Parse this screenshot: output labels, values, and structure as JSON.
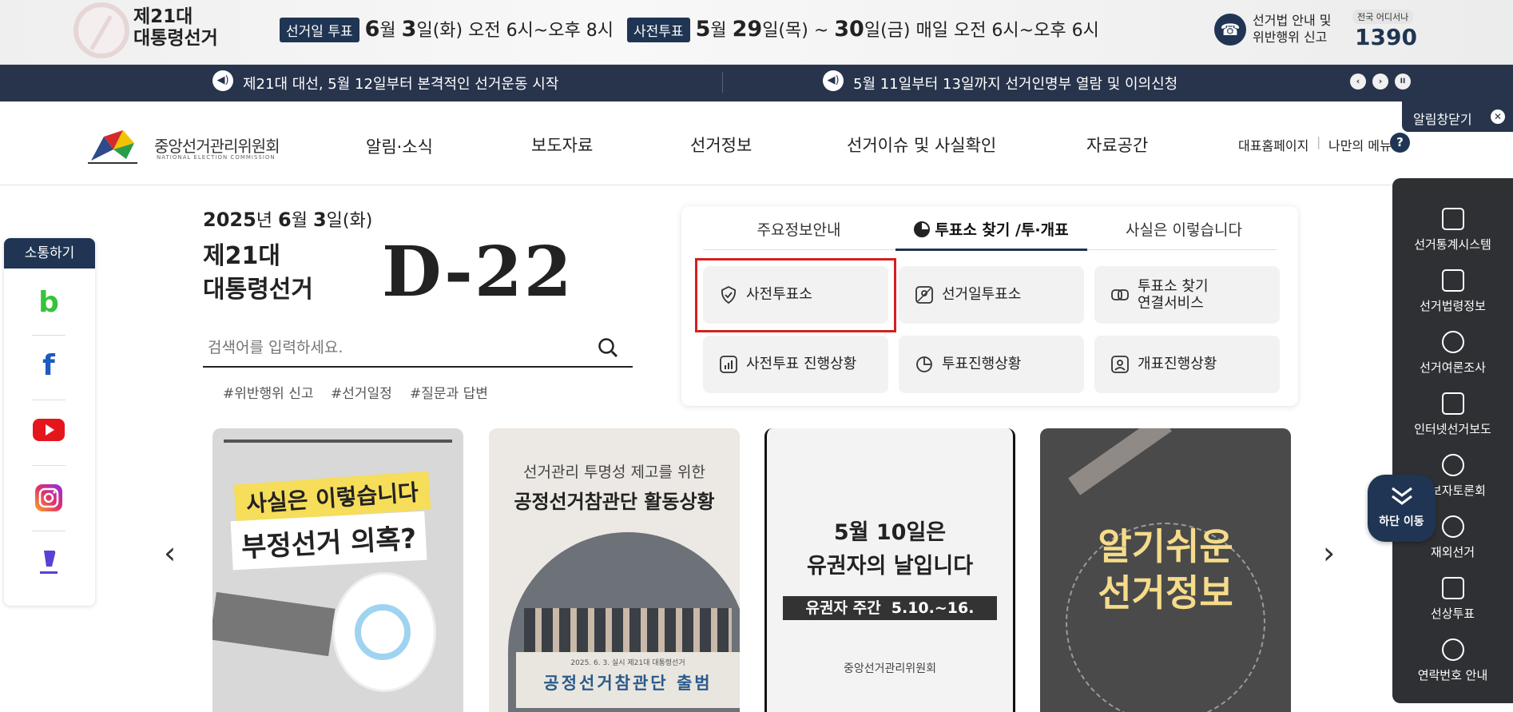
{
  "top_banner": {
    "election_title_line1": "제21대",
    "election_title_line2": "대통령선거",
    "election_day_tag": "선거일 투표",
    "election_day_month": "6",
    "election_day_month_suffix": "월",
    "election_day_day": "3",
    "election_day_rest": "일(화) 오전 6시~오후 8시",
    "early_tag": "사전투표",
    "early_month": "5",
    "early_month_suffix": "월",
    "early_day1": "29",
    "early_mid": "일(목) ~",
    "early_day2": "30",
    "early_rest": "일(금) 매일 오전 6시~오후 6시",
    "law_line1": "선거법 안내 및",
    "law_line2": "위반행위 신고",
    "nationwide": "전국 어디서나",
    "hotline": "1390"
  },
  "notice_bar": {
    "item1": "제21대 대선, 5월 12일부터 본격적인 선거운동 시작",
    "item2": "5월 11일부터 13일까지 선거인명부 열람 및 이의신청",
    "prev": "‹",
    "next": "›",
    "pause": "II",
    "close_label": "알림창닫기",
    "close_x": "✕"
  },
  "header": {
    "org_name": "중앙선거관리위원회",
    "org_name_en": "NATIONAL ELECTION COMMISSION",
    "nav": [
      "알림·소식",
      "보도자료",
      "선거정보",
      "선거이슈 및 사실확인",
      "자료공간"
    ],
    "util_home": "대표홈페이지",
    "util_sep": "|",
    "util_my": "나만의 메뉴",
    "help": "?"
  },
  "sns": {
    "title": "소통하기"
  },
  "main": {
    "date_year": "2025",
    "date_year_suffix": "년 ",
    "date_month": "6",
    "date_month_suffix": "월 ",
    "date_day": "3",
    "date_day_suffix": "일(화)",
    "election_line1": "제21대",
    "election_line2": "대통령선거",
    "dday": "D-22",
    "search_placeholder": "검색어를 입력하세요.",
    "tags": [
      "#위반행위 신고",
      "#선거일정",
      "#질문과 답변"
    ]
  },
  "panel": {
    "tabs": [
      "주요정보안내",
      "투표소 찾기 /투·개표",
      "사실은 이렇습니다"
    ],
    "cards": [
      {
        "line1": "사전투표소",
        "line2": ""
      },
      {
        "line1": "선거일투표소",
        "line2": ""
      },
      {
        "line1": "투표소 찾기",
        "line2": "연결서비스"
      },
      {
        "line1": "사전투표 진행상황",
        "line2": ""
      },
      {
        "line1": "투표진행상황",
        "line2": ""
      },
      {
        "line1": "개표진행상황",
        "line2": ""
      }
    ]
  },
  "banners": {
    "b1_line1": "사실은 이렇습니다",
    "b1_line2": "부정선거 의혹?",
    "b2_line1": "선거관리 투명성 제고를 위한",
    "b2_line2": "공정선거참관단 활동상황",
    "b2_photo_small": "2025. 6. 3. 실시 제21대 대통령선거",
    "b2_photo_big": "공정선거참관단 출범",
    "b3_line1": "5월 10일은",
    "b3_line2": "유권자의 날입니다",
    "b3_strip": "유권자 주간  5.10.~16.",
    "b3_org": "중앙선거관리위원회",
    "b4_line1": "알기쉬운",
    "b4_line2": "선거정보",
    "prev": "‹",
    "next": "›"
  },
  "quick_menu": {
    "items": [
      "선거통계시스템",
      "선거법령정보",
      "선거여론조사",
      "인터넷선거보도",
      "후보자토론회",
      "재외선거",
      "선상투표",
      "연락번호 안내"
    ],
    "go_bottom": "하단 이동"
  },
  "colors": {
    "navy": "#1f3553",
    "notice_bg": "#27344c",
    "highlight": "#d51f1f",
    "quick_menu_bg": "#2f3033"
  }
}
